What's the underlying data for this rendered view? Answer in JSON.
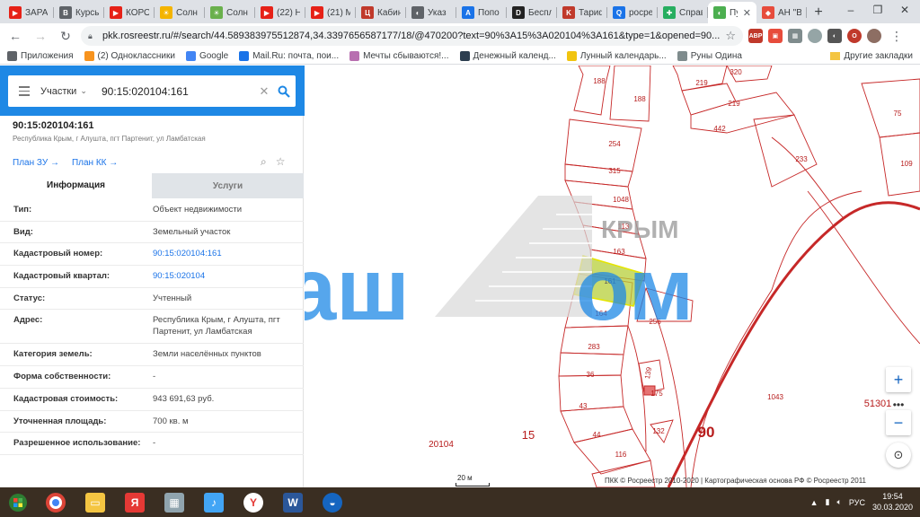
{
  "browser": {
    "tabs": [
      {
        "label": "ЗАРА",
        "color": "#e62117",
        "glyph": "▶"
      },
      {
        "label": "Курсы",
        "color": "#5f6368",
        "glyph": "В"
      },
      {
        "label": "КОРО",
        "color": "#e62117",
        "glyph": "▶"
      },
      {
        "label": "Солн",
        "color": "#f4b400",
        "glyph": "☀"
      },
      {
        "label": "Солн",
        "color": "#6ab04c",
        "glyph": "☀"
      },
      {
        "label": "(22) Н",
        "color": "#e62117",
        "glyph": "▶"
      },
      {
        "label": "(21) М",
        "color": "#e62117",
        "glyph": "▶"
      },
      {
        "label": "Кабин",
        "color": "#c0392b",
        "glyph": "Ц"
      },
      {
        "label": "Указ",
        "color": "#5f6368",
        "glyph": "◐"
      },
      {
        "label": "Попо",
        "color": "#1a73e8",
        "glyph": "A"
      },
      {
        "label": "Беспл",
        "color": "#222222",
        "glyph": "D"
      },
      {
        "label": "Тариф",
        "color": "#c0392b",
        "glyph": "K"
      },
      {
        "label": "росре",
        "color": "#1a73e8",
        "glyph": "Q"
      },
      {
        "label": "Справ",
        "color": "#27ae60",
        "glyph": "✚"
      },
      {
        "label": "Пу",
        "color": "#4caf50",
        "glyph": "◐",
        "active": true
      },
      {
        "label": "АН \"В",
        "color": "#e74c3c",
        "glyph": "◆"
      }
    ],
    "url": "pkk.rosreestr.ru/#/search/44.589383975512874,34.3397656587177/18/@470200?text=90%3A15%3A020104%3A161&type=1&opened=90...",
    "bookmarks": [
      {
        "label": "Приложения",
        "color": "#5f6368"
      },
      {
        "label": "(2) Одноклассники",
        "color": "#f7931e"
      },
      {
        "label": "Google",
        "color": "#4285f4"
      },
      {
        "label": "Mail.Ru: почта, пои...",
        "color": "#1a73e8"
      },
      {
        "label": "Мечты сбываются!...",
        "color": "#b86fb0"
      },
      {
        "label": "Денежный календ...",
        "color": "#2c3e50"
      },
      {
        "label": "Лунный календарь...",
        "color": "#f1c40f"
      },
      {
        "label": "Руны Одина",
        "color": "#7f8c8d"
      }
    ],
    "other_bookmarks": "Другие закладки"
  },
  "search": {
    "type": "Участки",
    "query": "90:15:020104:161"
  },
  "object": {
    "number": "90:15:020104:161",
    "address_short": "Республика Крым, г Алушта, пгт Партенит, ул Ламбатская",
    "link_zu": "План ЗУ",
    "link_kk": "План КК"
  },
  "panel_tabs": {
    "info": "Информация",
    "services": "Услуги"
  },
  "properties": [
    {
      "key": "Тип:",
      "value": "Объект недвижимости"
    },
    {
      "key": "Вид:",
      "value": "Земельный участок"
    },
    {
      "key": "Кадастровый номер:",
      "value": "90:15:020104:161",
      "link": true
    },
    {
      "key": "Кадастровый квартал:",
      "value": "90:15:020104",
      "link": true
    },
    {
      "key": "Статус:",
      "value": "Учтенный"
    },
    {
      "key": "Адрес:",
      "value": "Республика Крым, г Алушта, пгт Партенит, ул Ламбатская",
      "tall": true
    },
    {
      "key": "Категория земель:",
      "value": "Земли населённых пунктов"
    },
    {
      "key": "Форма собственности:",
      "value": "-"
    },
    {
      "key": "Кадастровая стоимость:",
      "value": "943 691,63 руб."
    },
    {
      "key": "Уточненная площадь:",
      "value": "700 кв. м"
    },
    {
      "key": "Разрешенное использование:",
      "value": "-"
    }
  ],
  "map": {
    "parcel_labels": [
      {
        "t": "188",
        "key": "a"
      },
      {
        "t": "188",
        "key": "b"
      },
      {
        "t": "219",
        "key": "c"
      },
      {
        "t": "219",
        "key": "d"
      },
      {
        "t": "320",
        "key": "e"
      },
      {
        "t": "442",
        "key": "f"
      },
      {
        "t": "254",
        "key": "g"
      },
      {
        "t": "315",
        "key": "h"
      },
      {
        "t": "1048",
        "key": "i"
      },
      {
        "t": "113",
        "key": "j"
      },
      {
        "t": "163",
        "key": "k"
      },
      {
        "t": "161",
        "key": "l"
      },
      {
        "t": "164",
        "key": "m"
      },
      {
        "t": "256",
        "key": "n"
      },
      {
        "t": "283",
        "key": "o"
      },
      {
        "t": "36",
        "key": "p"
      },
      {
        "t": "43",
        "key": "q"
      },
      {
        "t": "44",
        "key": "r"
      },
      {
        "t": "116",
        "key": "s"
      },
      {
        "t": "132",
        "key": "t"
      },
      {
        "t": "139",
        "key": "u"
      },
      {
        "t": "175",
        "key": "v"
      },
      {
        "t": "233",
        "key": "w"
      },
      {
        "t": "75",
        "key": "x"
      },
      {
        "t": "109",
        "key": "y"
      },
      {
        "t": "1043",
        "key": "z"
      }
    ],
    "quarter_labels": {
      "q1": "20104",
      "q2": "15",
      "q3": "90",
      "q4": "51301"
    },
    "watermark": {
      "word1": "Ваш",
      "word2": "ом",
      "region": "КРЫМ"
    },
    "scale": "20 м",
    "copyright": "ПКК © Росреестр 2010-2020 | Картографическая основа РФ © Росреестр 2011"
  },
  "taskbar": {
    "lang": "РУС",
    "time": "19:54",
    "date": "30.03.2020"
  }
}
